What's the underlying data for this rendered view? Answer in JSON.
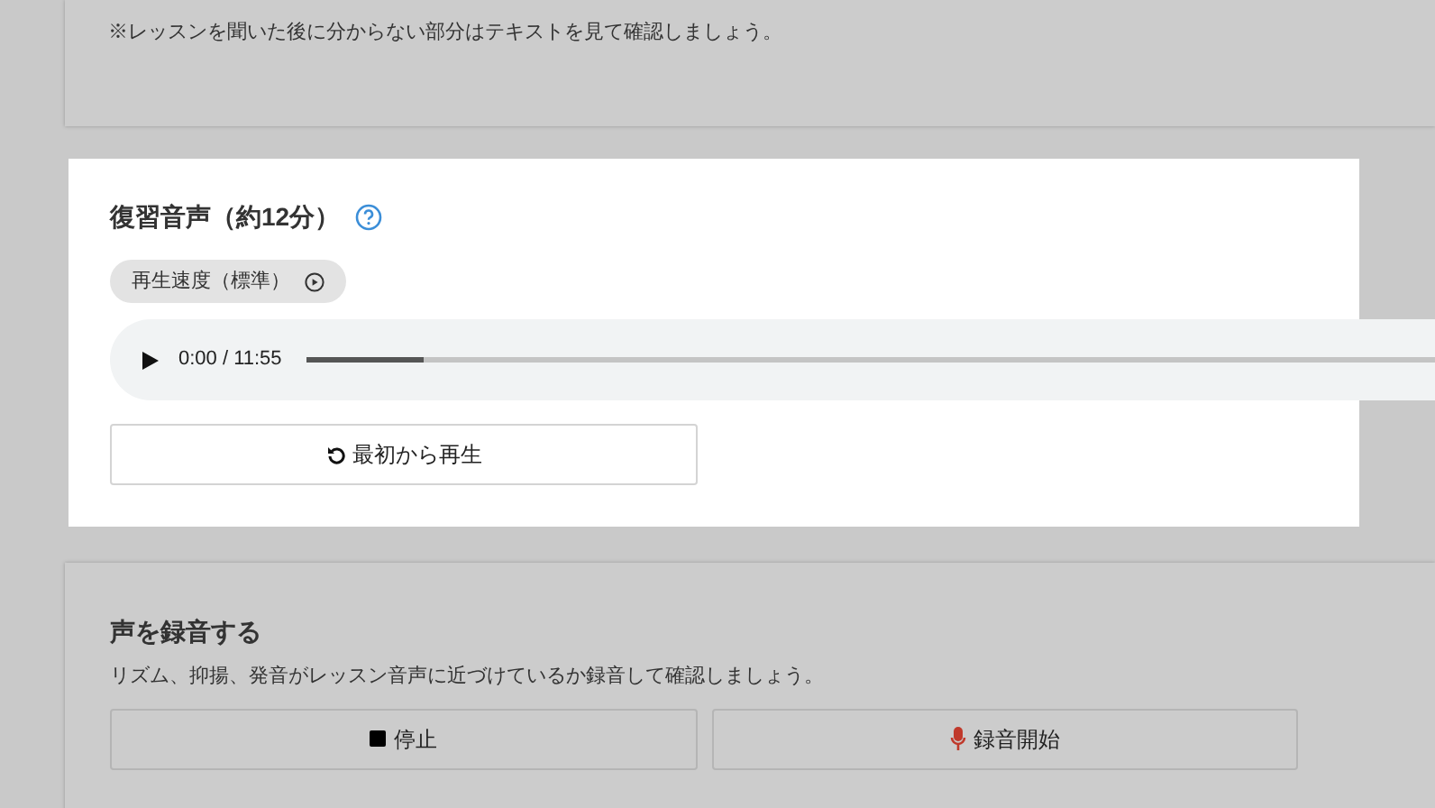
{
  "intro_card": {
    "note": "※レッスンを聞いた後に分からない部分はテキストを見て確認しましょう。"
  },
  "review_audio": {
    "title": "復習音声（約12分）",
    "speed_button": "再生速度（標準）",
    "player": {
      "playing": false,
      "time": "0:00 / 11:55",
      "level": 0.1
    },
    "restart_button": "最初から再生"
  },
  "record": {
    "title": "声を録音する",
    "description": "リズム、抑揚、発音がレッスン音声に近づけているか録音して確認しましょう。",
    "buttons": [
      {
        "kind": "stop",
        "label": "停止"
      },
      {
        "kind": "record",
        "label": "録音開始"
      }
    ]
  }
}
